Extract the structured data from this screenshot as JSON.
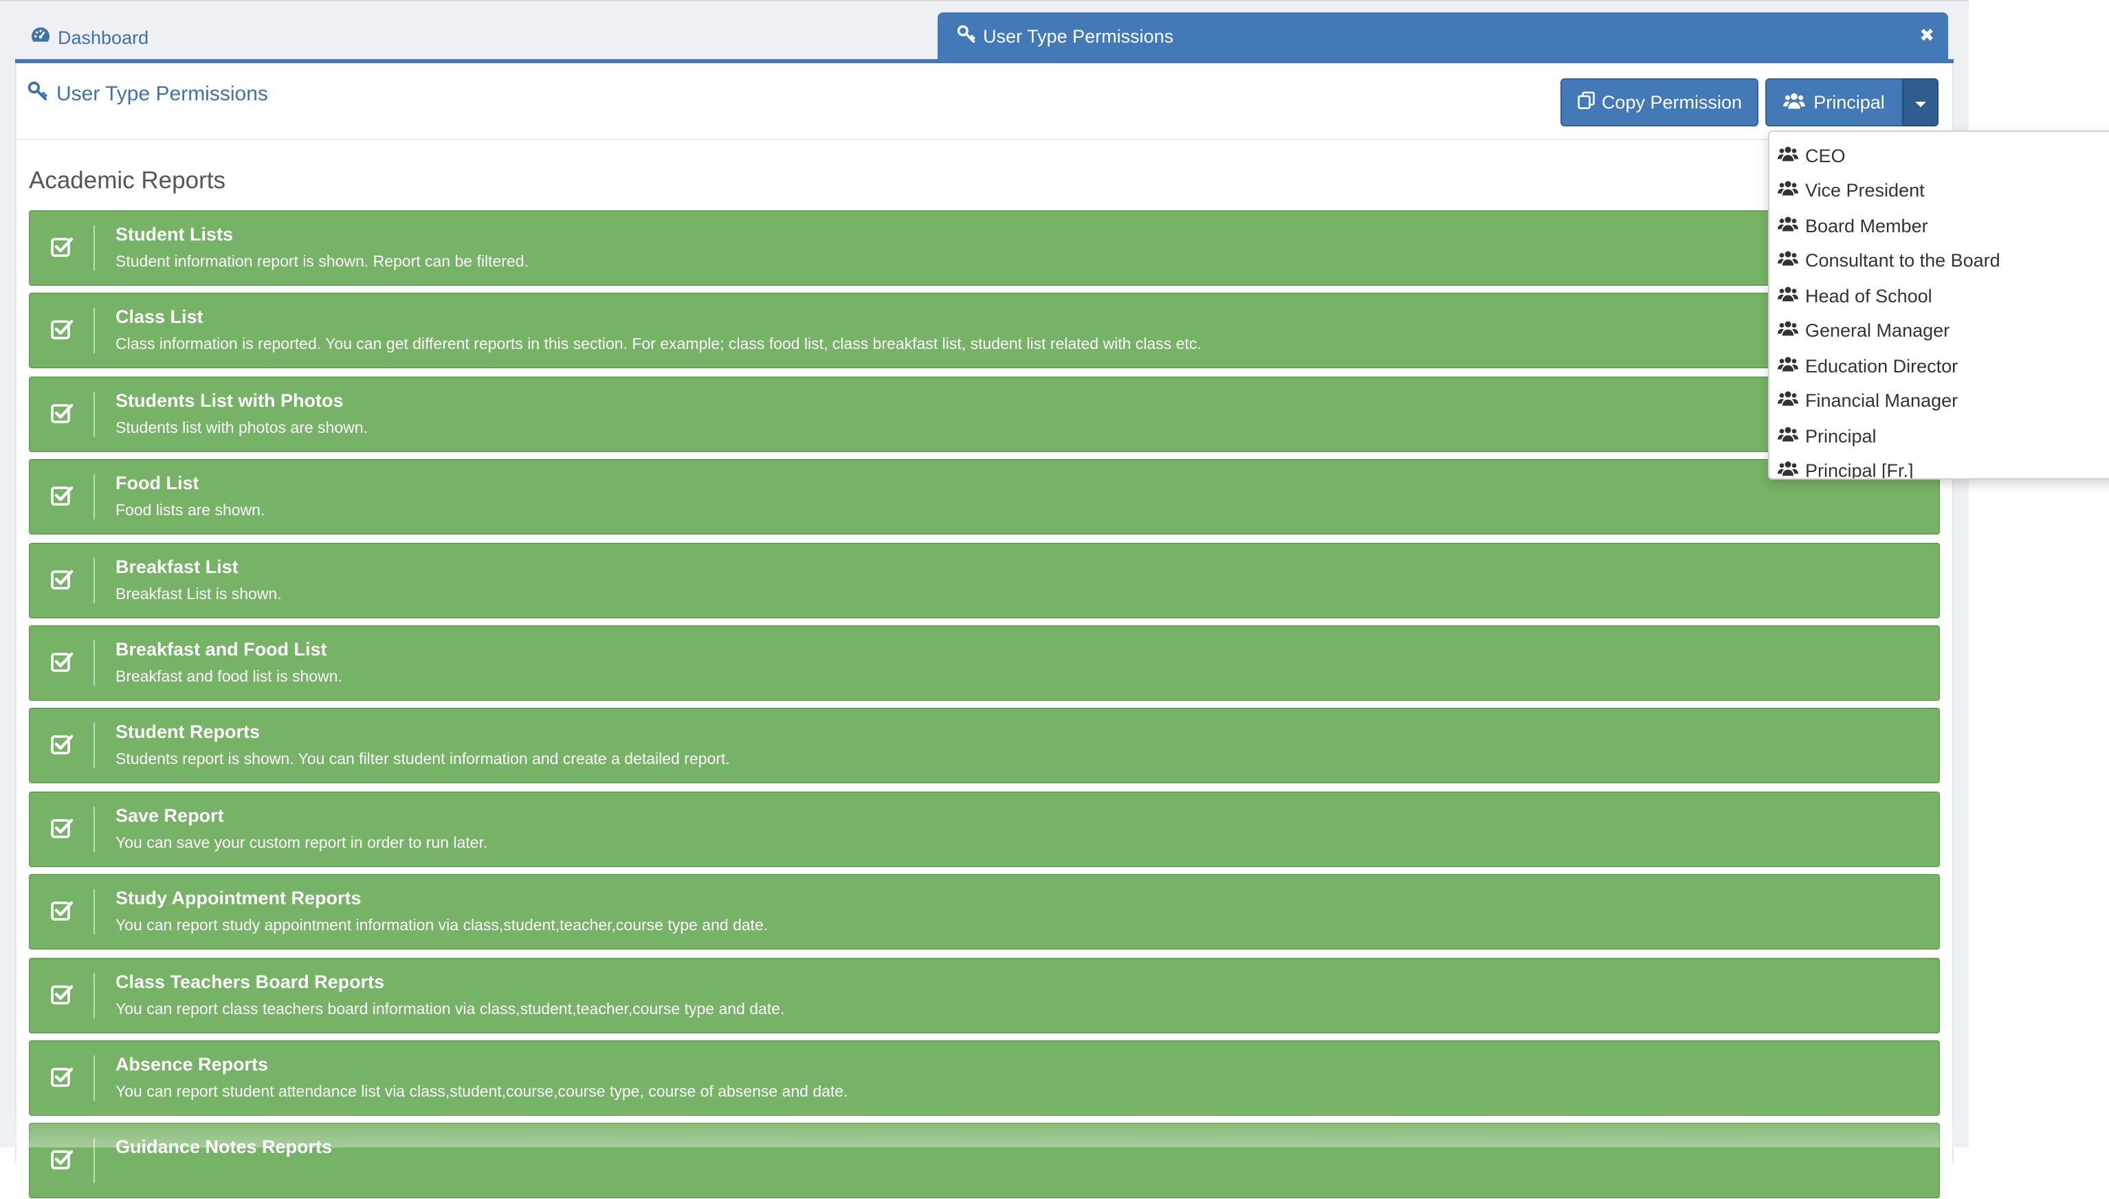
{
  "tabs": {
    "dashboard_label": "Dashboard",
    "active_label": "User Type Permissions",
    "close_glyph": "✖"
  },
  "header": {
    "title": "User Type Permissions",
    "copy_button": "Copy Permission",
    "role_button": "Principal"
  },
  "section": {
    "title": "Academic Reports"
  },
  "permissions": [
    {
      "title": "Student Lists",
      "desc": "Student information report is shown. Report can be filtered."
    },
    {
      "title": "Class List",
      "desc": "Class information is reported. You can get different reports in this section. For example; class food list, class breakfast list, student list related with class etc."
    },
    {
      "title": "Students List with Photos",
      "desc": "Students list with photos are shown."
    },
    {
      "title": "Food List",
      "desc": "Food lists are shown."
    },
    {
      "title": "Breakfast List",
      "desc": "Breakfast List is shown."
    },
    {
      "title": "Breakfast and Food List",
      "desc": "Breakfast and food list is shown."
    },
    {
      "title": "Student Reports",
      "desc": "Students report is shown. You can filter student information and create a detailed report."
    },
    {
      "title": "Save Report",
      "desc": "You can save your custom report in order to run later."
    },
    {
      "title": "Study Appointment Reports",
      "desc": "You can report study appointment information via class,student,teacher,course type and date."
    },
    {
      "title": "Class Teachers Board Reports",
      "desc": "You can report class teachers board information via class,student,teacher,course type and date."
    },
    {
      "title": "Absence Reports",
      "desc": "You can report student attendance list via class,student,course,course type, course of absense and date."
    },
    {
      "title": "Guidance Notes Reports",
      "desc": ""
    }
  ],
  "dropdown": {
    "items": [
      "CEO",
      "Vice President",
      "Board Member",
      "Consultant to the Board",
      "Head of School",
      "General Manager",
      "Education Director",
      "Financial Manager",
      "Principal",
      "Principal [Fr.]"
    ]
  },
  "colors": {
    "primary": "#4279b6",
    "row_green": "#77b366",
    "link_blue": "#3d72ad"
  }
}
